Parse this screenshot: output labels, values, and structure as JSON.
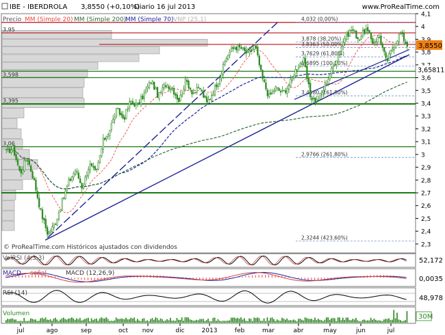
{
  "header": {
    "symbol": "IBE - IBERDROLA",
    "price": "3,8550 (+0,10%)",
    "period": "Diario  16 jul 2013",
    "site": "www.ProRealTime.com"
  },
  "legend": {
    "precio": "Precio",
    "mm20": "MM (Simple 20)",
    "mm200": "MM (Simple 200)",
    "mm70": "MM (Simple 70)",
    "vnp": "VNP (25,1)"
  },
  "footer_credit": "© ProRealTime.com  Históricos ajustados con dividendos",
  "colors": {
    "candle": "#2e8b22",
    "mm20": "#e8483c",
    "mm200": "#2f6a3c",
    "mm70": "#1b1f9c",
    "vnp": "#b8b8b8",
    "resistance": "#b7121a",
    "support": "#1b7a14",
    "trend": "#1d2396",
    "price_tag": "#f07f10",
    "panel_bg": "#ffffff",
    "frame": "#000000"
  },
  "chart_data": [
    {
      "type": "candlestick",
      "title": "IBE - IBERDROLA",
      "x_ticks": [
        "jul",
        "ago",
        "sep",
        "oct",
        "nov",
        "dic",
        "2013",
        "feb",
        "mar",
        "abr",
        "may",
        "jun",
        "jul"
      ],
      "ylim": [
        2.23,
        4.1
      ],
      "y_ticks": [
        "2,3",
        "2,4",
        "2,5",
        "2,6",
        "2,7",
        "2,8",
        "2,9",
        "3",
        "3,1",
        "3,2",
        "3,3",
        "3,4",
        "3,5",
        "3,6",
        "3,7",
        "3,8",
        "3,9",
        "4",
        "4,1"
      ],
      "last_price_label": "3,8550",
      "second_price_label": "3,65811",
      "volume_profile_labels": [
        "3,95",
        "3,598",
        "3,395",
        "3,06"
      ],
      "fibonacci_labels": [
        "4,032 (0,00%)",
        "3,878 (38,20%)",
        "3,8363 (50,00%)",
        "3,7629 (61,80%)",
        "3,6895 (100,00%)",
        "3,4580 (161,80%)",
        "2,9766 (261,80%)",
        "2,3244 (423,60%)"
      ],
      "series": [
        {
          "name": "Precio",
          "style": "candlestick",
          "ohlc_from": "jul 2012",
          "ohlc_to": "16 jul 2013"
        },
        {
          "name": "MM (Simple 20)",
          "style": "dashed"
        },
        {
          "name": "MM (Simple 200)",
          "style": "dashed"
        },
        {
          "name": "MM (Simple 70)",
          "style": "dashed"
        }
      ],
      "horizontal_levels": [
        {
          "value": 4.032,
          "kind": "resistance"
        },
        {
          "value": 3.95,
          "kind": "resistance"
        },
        {
          "value": 3.86,
          "kind": "resistance"
        },
        {
          "value": 3.65,
          "kind": "support"
        },
        {
          "value": 3.6,
          "kind": "support"
        },
        {
          "value": 3.395,
          "kind": "support"
        },
        {
          "value": 3.06,
          "kind": "support"
        },
        {
          "value": 2.7,
          "kind": "support"
        }
      ],
      "close_profile": [
        [
          "jul",
          3.02
        ],
        [
          "jul",
          3.05
        ],
        [
          "jul",
          2.85
        ],
        [
          "jul",
          2.98
        ],
        [
          "jul",
          2.8
        ],
        [
          "jul",
          2.55
        ],
        [
          "jul",
          2.38
        ],
        [
          "jul",
          2.45
        ],
        [
          "ago",
          2.62
        ],
        [
          "ago",
          2.78
        ],
        [
          "ago",
          2.88
        ],
        [
          "ago",
          2.74
        ],
        [
          "ago",
          2.92
        ],
        [
          "sep",
          2.85
        ],
        [
          "sep",
          3.1
        ],
        [
          "sep",
          3.2
        ],
        [
          "sep",
          3.35
        ],
        [
          "sep",
          3.28
        ],
        [
          "oct",
          3.42
        ],
        [
          "oct",
          3.38
        ],
        [
          "oct",
          3.48
        ],
        [
          "oct",
          3.58
        ],
        [
          "oct",
          3.45
        ],
        [
          "nov",
          3.55
        ],
        [
          "nov",
          3.52
        ],
        [
          "nov",
          3.42
        ],
        [
          "nov",
          3.58
        ],
        [
          "nov",
          3.48
        ],
        [
          "dic",
          3.52
        ],
        [
          "dic",
          3.4
        ],
        [
          "dic",
          3.5
        ],
        [
          "dic",
          3.62
        ],
        [
          "2013",
          3.78
        ],
        [
          "2013",
          3.84
        ],
        [
          "2013",
          3.83
        ],
        [
          "2013",
          3.78
        ],
        [
          "feb",
          3.85
        ],
        [
          "feb",
          3.6
        ],
        [
          "feb",
          3.45
        ],
        [
          "feb",
          3.52
        ],
        [
          "mar",
          3.48
        ],
        [
          "mar",
          3.55
        ],
        [
          "mar",
          3.68
        ],
        [
          "mar",
          3.74
        ],
        [
          "abr",
          3.45
        ],
        [
          "abr",
          3.42
        ],
        [
          "abr",
          3.52
        ],
        [
          "abr",
          3.65
        ],
        [
          "may",
          3.78
        ],
        [
          "may",
          3.92
        ],
        [
          "may",
          3.98
        ],
        [
          "may",
          3.9
        ],
        [
          "jun",
          3.98
        ],
        [
          "jun",
          3.88
        ],
        [
          "jun",
          3.92
        ],
        [
          "jun",
          3.72
        ],
        [
          "jul",
          3.85
        ],
        [
          "jul",
          3.95
        ],
        [
          "jul",
          3.855
        ]
      ]
    },
    {
      "type": "line",
      "title": "VolRSI",
      "label": "VolRSI (4,3,3)",
      "last_value_label": "52,172"
    },
    {
      "type": "line",
      "title": "MACD",
      "labels": [
        "MACD",
        "señal",
        "MACD (12,26,9)"
      ],
      "last_value_label": "0,0035"
    },
    {
      "type": "line",
      "title": "RSI",
      "label": "RSI (14)",
      "last_value_label": "48,978"
    },
    {
      "type": "bar",
      "title": "Volumen",
      "label": "Volumen",
      "last_value_label": "30M"
    }
  ]
}
